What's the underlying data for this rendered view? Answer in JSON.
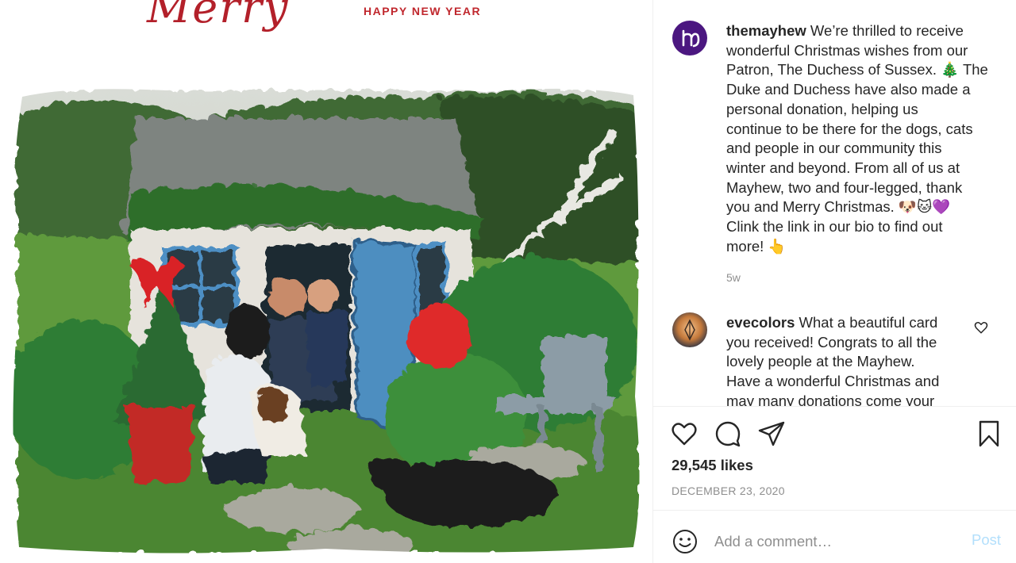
{
  "card": {
    "script_heading": "Merry",
    "subtitle": "HAPPY NEW YEAR"
  },
  "post": {
    "author": "themayhew",
    "caption_lines": [
      " We’re thrilled to receive",
      "wonderful Christmas wishes from our",
      "Patron, The Duchess of Sussex. 🎄 The",
      "Duke and Duchess have also made a",
      "personal donation, helping us",
      "continue to be there for the dogs, cats",
      "and people in our community this",
      "winter and beyond. From all of us at",
      "Mayhew, two and four-legged, thank",
      "you and Merry Christmas. 🐶🐱💜",
      "Clink the link in our bio to find out",
      "more! 👆"
    ],
    "time_ago": "5w",
    "likes": "29,545 likes",
    "date": "DECEMBER 23, 2020"
  },
  "comment": {
    "author": "evecolors",
    "text_lines": [
      " What a beautiful card",
      "you received! Congrats to all the",
      "lovely people at the Mayhew.",
      "Have a wonderful Christmas and",
      "may many donations come your"
    ]
  },
  "add_comment": {
    "placeholder": "Add a comment…",
    "post_label": "Post"
  },
  "icons": {
    "like": "heart-icon",
    "comment": "comment-icon",
    "share": "paper-plane-icon",
    "save": "bookmark-icon",
    "emoji": "smiley-icon",
    "comment_like": "heart-icon"
  },
  "colors": {
    "mayhew_avatar": "#4b1780",
    "post_button": "#b2dffc",
    "muted_text": "#8e8e8e"
  }
}
